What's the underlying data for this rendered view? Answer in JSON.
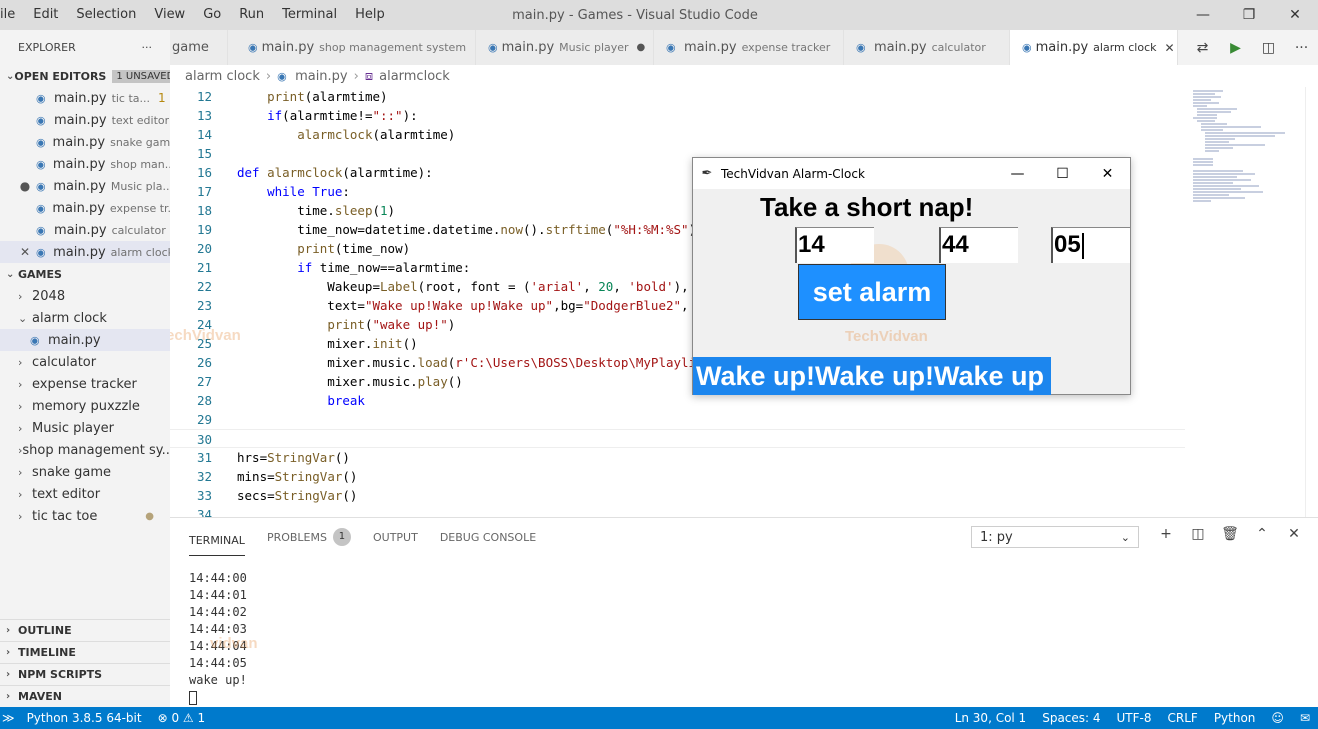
{
  "window": {
    "title": "main.py - Games - Visual Studio Code",
    "menu": [
      "ile",
      "Edit",
      "Selection",
      "View",
      "Go",
      "Run",
      "Terminal",
      "Help"
    ]
  },
  "sidebar": {
    "explorer_label": "EXPLORER",
    "more": "···",
    "open_editors_label": "OPEN EDITORS",
    "unsaved_badge": "1 UNSAVED",
    "open_editors": [
      {
        "name": "main.py",
        "desc": "tic ta...",
        "count": "1",
        "mark": ""
      },
      {
        "name": "main.py",
        "desc": "text editor",
        "mark": ""
      },
      {
        "name": "main.py",
        "desc": "snake game",
        "mark": ""
      },
      {
        "name": "main.py",
        "desc": "shop man...",
        "mark": ""
      },
      {
        "name": "main.py",
        "desc": "Music pla...",
        "mark": "●"
      },
      {
        "name": "main.py",
        "desc": "expense tr...",
        "mark": ""
      },
      {
        "name": "main.py",
        "desc": "calculator",
        "mark": ""
      },
      {
        "name": "main.py",
        "desc": "alarm clock",
        "mark": "✕"
      }
    ],
    "games_label": "GAMES",
    "tree": {
      "f2048": "2048",
      "alarm_clock": "alarm clock",
      "alarm_main": "main.py",
      "calculator": "calculator",
      "expense_tracker": "expense tracker",
      "memory_puzzle": "memory puxzzle",
      "music_player": "Music player",
      "shop": "shop management sy...",
      "snake": "snake game",
      "text_editor": "text editor",
      "tic_tac_toe": "tic tac toe"
    },
    "bottom_sections": [
      "OUTLINE",
      "TIMELINE",
      "NPM SCRIPTS",
      "MAVEN"
    ]
  },
  "tabs": [
    {
      "name": "game",
      "desc": ""
    },
    {
      "name": "main.py",
      "desc": "shop management system"
    },
    {
      "name": "main.py",
      "desc": "Music player",
      "dirty": "●"
    },
    {
      "name": "main.py",
      "desc": "expense tracker"
    },
    {
      "name": "main.py",
      "desc": "calculator"
    },
    {
      "name": "main.py",
      "desc": "alarm clock",
      "close": "✕"
    }
  ],
  "breadcrumb": {
    "folder": "alarm clock",
    "file": "main.py",
    "symbol": "alarmclock"
  },
  "panel": {
    "tabs": {
      "terminal": "TERMINAL",
      "problems": "PROBLEMS",
      "problems_count": "1",
      "output": "OUTPUT",
      "debug": "DEBUG CONSOLE"
    },
    "terminal_select": "1: py",
    "terminal_lines": [
      "14:44:00",
      "14:44:01",
      "14:44:02",
      "14:44:03",
      "14:44:04",
      "14:44:05",
      "wake up!"
    ]
  },
  "status": {
    "python": "Python 3.8.5 64-bit",
    "problems": "⊗ 0 ⚠ 1",
    "position": "Ln 30, Col 1",
    "spaces": "Spaces: 4",
    "encoding": "UTF-8",
    "eol": "CRLF",
    "language": "Python"
  },
  "tk": {
    "title": "TechVidvan Alarm-Clock",
    "heading": "Take a short nap!",
    "hours": "14",
    "minutes": "44",
    "seconds": "05",
    "button": "set alarm",
    "wake_label": "Wake up!Wake up!Wake up"
  },
  "watermark": "TechVidvan",
  "watermark_partial": "vidvan",
  "colors": {
    "accent": "#007acc",
    "tk_button": "#1e90ff",
    "wake_bg": "#1c86ee"
  }
}
